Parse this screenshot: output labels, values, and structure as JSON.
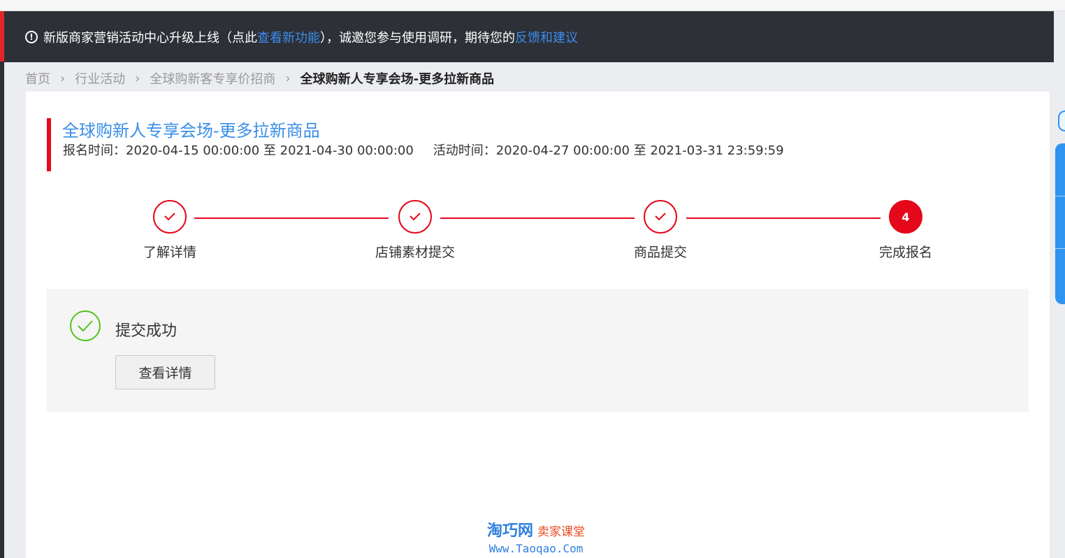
{
  "notice": {
    "text_1": "新版商家营销活动中心升级上线（点此",
    "link_1": "查看新功能",
    "text_2": "），诚邀您参与使用调研，期待您的",
    "link_2": "反馈和建议",
    "icon": "info-icon"
  },
  "breadcrumb": {
    "items": [
      "首页",
      "行业活动",
      "全球购新客专享价招商",
      "全球购新人专享会场-更多拉新商品"
    ]
  },
  "activity": {
    "title": "全球购新人专享会场-更多拉新商品",
    "signup_time": "报名时间：2020-04-15 00:00:00 至 2021-04-30 00:00:00",
    "activity_time": "活动时间：2020-04-27 00:00:00 至 2021-03-31 23:59:59"
  },
  "steps": [
    {
      "label": "了解详情",
      "status": "done"
    },
    {
      "label": "店铺素材提交",
      "status": "done"
    },
    {
      "label": "商品提交",
      "status": "done"
    },
    {
      "label": "完成报名",
      "status": "current",
      "number": "4"
    }
  ],
  "result": {
    "message": "提交成功",
    "button_label": "查看详情"
  },
  "watermark": {
    "brand": "淘巧网",
    "sub": "卖家课堂",
    "url": "Www.Taoqao.Com"
  },
  "colors": {
    "accent_red": "#e5081b",
    "link_blue": "#3a8ee6",
    "success_green": "#52c41a",
    "notice_bg": "#2d3036"
  }
}
